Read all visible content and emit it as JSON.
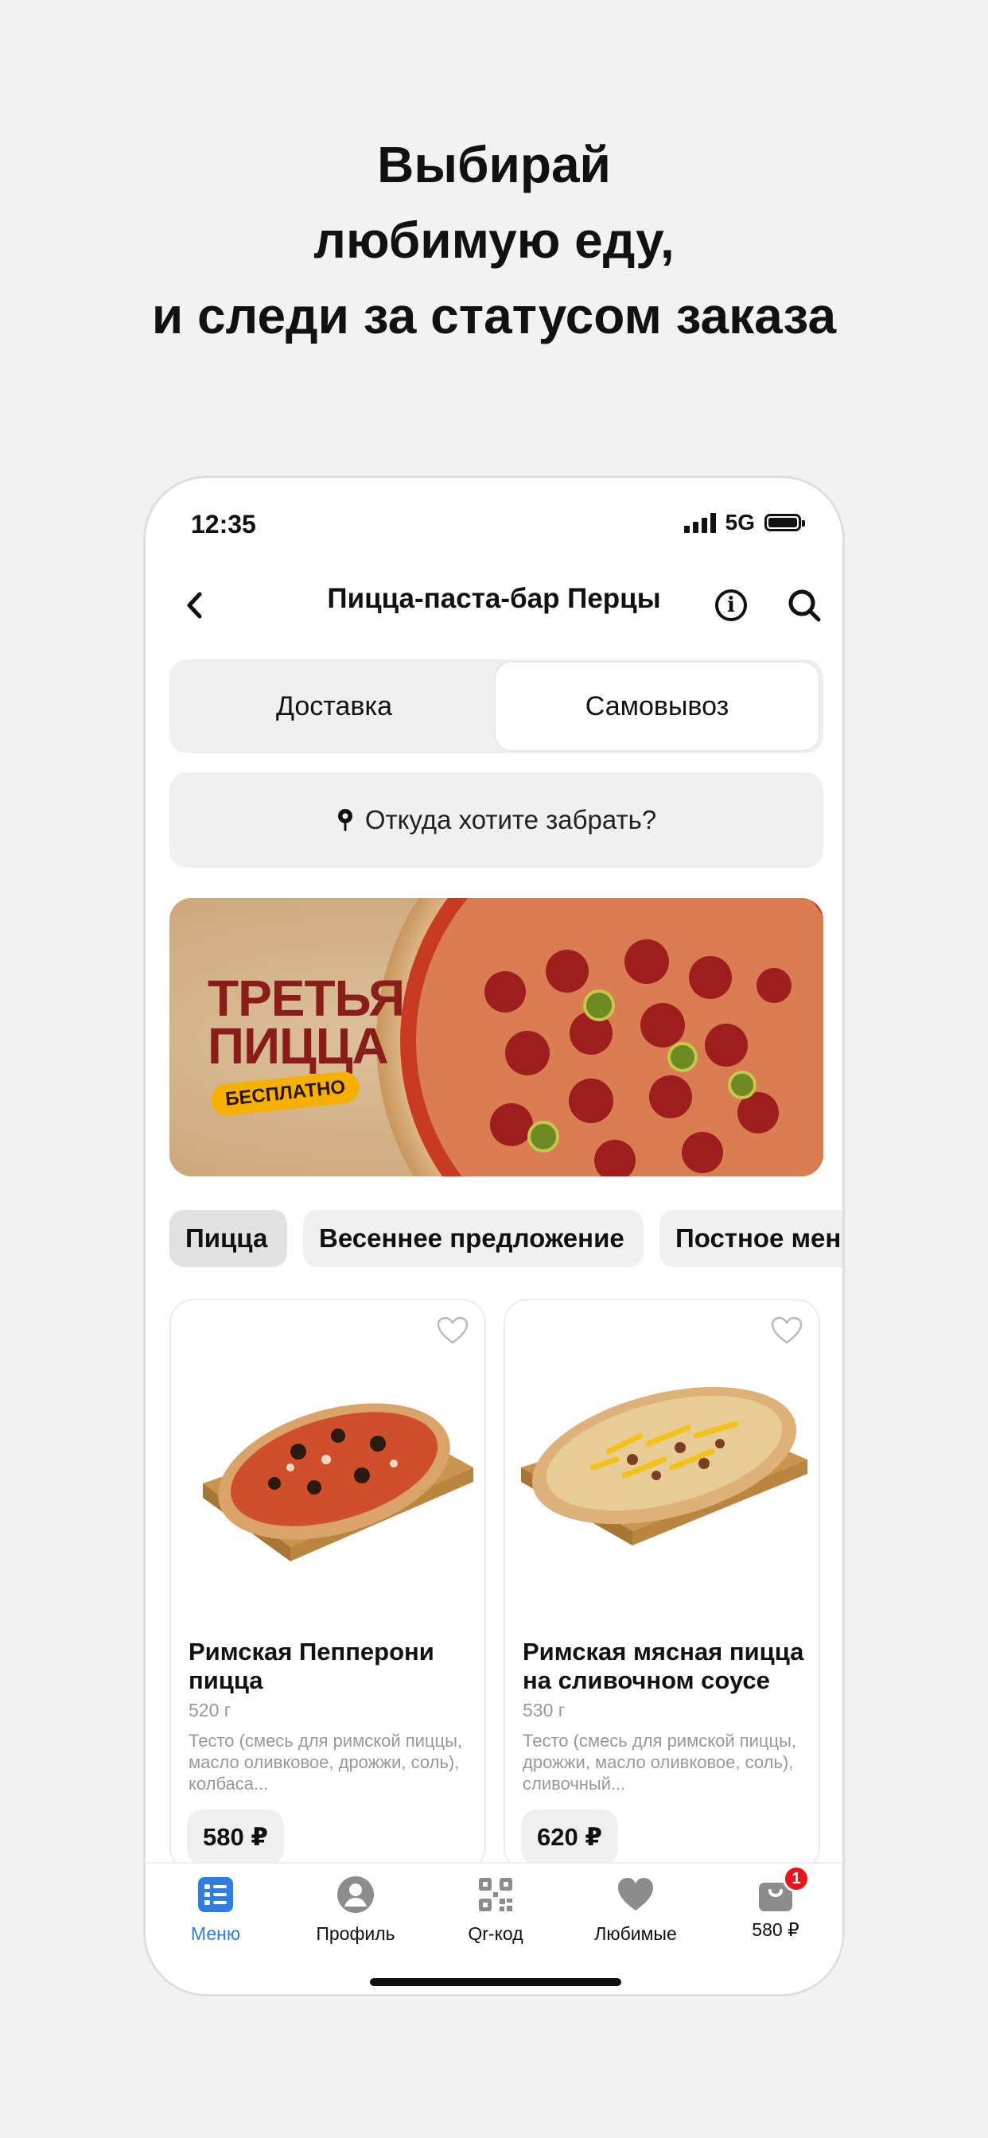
{
  "headline": [
    "Выбирай",
    "любимую еду,",
    "и следи за статусом заказа"
  ],
  "status": {
    "time": "12:35",
    "network": "5G"
  },
  "header": {
    "title": "Пицца-паста-бар Перцы"
  },
  "mode": {
    "delivery": "Доставка",
    "pickup": "Самовывоз",
    "selected": "pickup"
  },
  "pickup": {
    "prompt": "Откуда хотите забрать?"
  },
  "banner": {
    "line1": "ТРЕТЬЯ",
    "line2": "ПИЦЦА",
    "badge": "БЕСПЛАТНО"
  },
  "categories": [
    {
      "label": "Пицца",
      "active": true
    },
    {
      "label": "Весеннее предложение",
      "active": false
    },
    {
      "label": "Постное мен",
      "active": false
    }
  ],
  "products": [
    {
      "name": "Римская Пепперони пицца",
      "weight": "520 г",
      "description": "Тесто (смесь для римской пиццы, масло оливковое, дрожжи, соль), колбаса...",
      "price": "580 ₽"
    },
    {
      "name": "Римская мясная пицца на сливочном соусе",
      "weight": "530 г",
      "description": "Тесто (смесь для римской пиццы, дрожжи, масло оливковое, соль), сливочный...",
      "price": "620 ₽"
    }
  ],
  "tabbar": {
    "items": [
      {
        "label": "Меню",
        "icon": "menu-icon",
        "active": true
      },
      {
        "label": "Профиль",
        "icon": "profile-icon",
        "active": false
      },
      {
        "label": "Qr-код",
        "icon": "qr-icon",
        "active": false
      },
      {
        "label": "Любимые",
        "icon": "heart-icon",
        "active": false
      },
      {
        "label": "580 ₽",
        "icon": "cart-icon",
        "active": false
      }
    ],
    "cart_count": "1"
  },
  "colors": {
    "accent": "#2f7de1",
    "badge": "#e8141c",
    "banner_text": "#8a1c1a",
    "banner_badge": "#f6b100"
  }
}
